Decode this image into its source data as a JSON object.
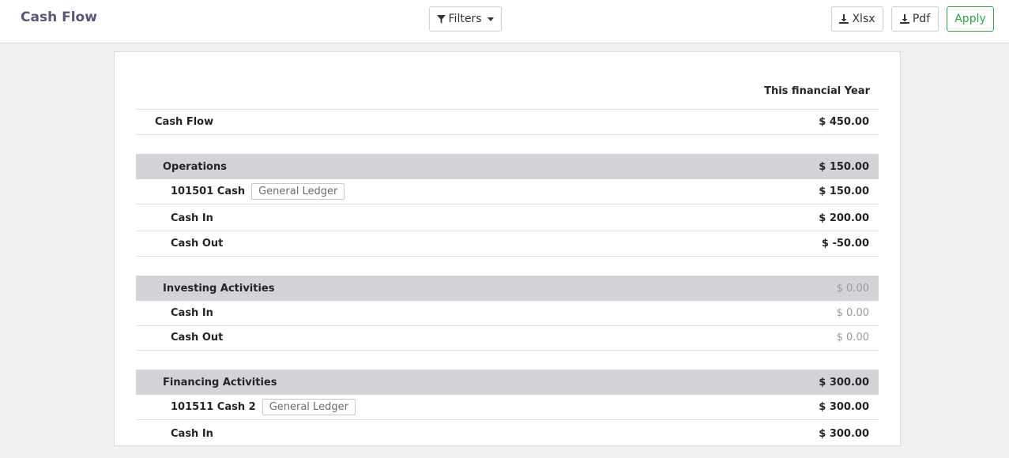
{
  "header": {
    "title": "Cash Flow",
    "filters_label": "Filters",
    "xlsx_label": "Xlsx",
    "pdf_label": "Pdf",
    "apply_label": "Apply"
  },
  "report": {
    "column_header": "This financial Year",
    "total": {
      "label": "Cash Flow",
      "value": "$ 450.00"
    },
    "operations": {
      "label": "Operations",
      "value": "$ 150.00",
      "account": {
        "label": "101501 Cash",
        "badge": "General Ledger",
        "value": "$ 150.00"
      },
      "cash_in": {
        "label": "Cash In",
        "value": "$ 200.00"
      },
      "cash_out": {
        "label": "Cash Out",
        "value": "$ -50.00"
      }
    },
    "investing": {
      "label": "Investing Activities",
      "value": "$ 0.00",
      "cash_in": {
        "label": "Cash In",
        "value": "$ 0.00"
      },
      "cash_out": {
        "label": "Cash Out",
        "value": "$ 0.00"
      }
    },
    "financing": {
      "label": "Financing Activities",
      "value": "$ 300.00",
      "account": {
        "label": "101511 Cash 2",
        "badge": "General Ledger",
        "value": "$ 300.00"
      },
      "cash_in": {
        "label": "Cash In",
        "value": "$ 300.00"
      }
    }
  },
  "colors": {
    "title": "#5c5378",
    "apply": "#28a745",
    "section_bg": "#d4d4d8"
  }
}
